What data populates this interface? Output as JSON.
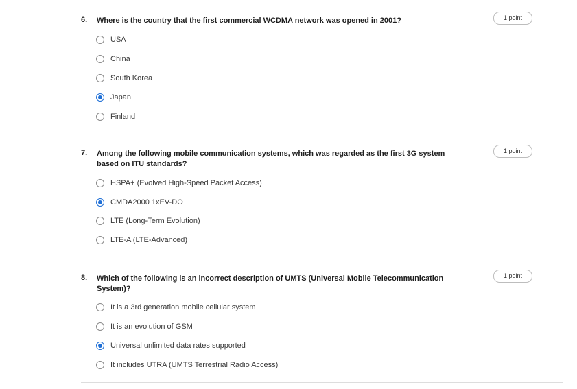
{
  "questions": [
    {
      "number": "6.",
      "text": "Where is the country that the first commercial WCDMA network was opened in 2001?",
      "points": "1 point",
      "options": [
        {
          "label": "USA",
          "selected": false
        },
        {
          "label": "China",
          "selected": false
        },
        {
          "label": "South Korea",
          "selected": false
        },
        {
          "label": "Japan",
          "selected": true
        },
        {
          "label": "Finland",
          "selected": false
        }
      ]
    },
    {
      "number": "7.",
      "text": "Among the following mobile communication systems, which was regarded as the first 3G system based on ITU standards?",
      "points": "1 point",
      "options": [
        {
          "label": "HSPA+ (Evolved High-Speed Packet Access)",
          "selected": false
        },
        {
          "label": "CMDA2000 1xEV-DO",
          "selected": true
        },
        {
          "label": "LTE (Long-Term Evolution)",
          "selected": false
        },
        {
          "label": "LTE-A (LTE-Advanced)",
          "selected": false
        }
      ]
    },
    {
      "number": "8.",
      "text": "Which of the following is an incorrect description of UMTS (Universal Mobile Telecommunication System)?",
      "points": "1 point",
      "options": [
        {
          "label": "It is a 3rd generation mobile cellular system",
          "selected": false
        },
        {
          "label": "It is an evolution of GSM",
          "selected": false
        },
        {
          "label": "Universal unlimited data rates supported",
          "selected": true
        },
        {
          "label": "It includes UTRA (UMTS Terrestrial Radio Access)",
          "selected": false
        }
      ]
    }
  ],
  "colors": {
    "accent": "#1f6fd6",
    "text": "#1f1f1f",
    "border": "#bdbdbd"
  }
}
